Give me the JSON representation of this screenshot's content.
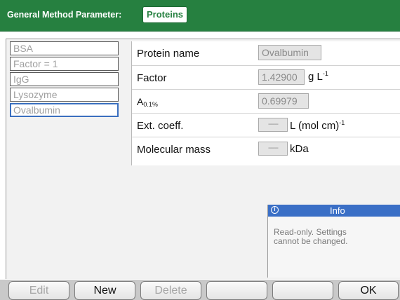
{
  "header": {
    "title": "General Method Parameter:",
    "tab": "Proteins"
  },
  "protein_list": [
    {
      "label": "BSA",
      "selected": false
    },
    {
      "label": "Factor = 1",
      "selected": false
    },
    {
      "label": "IgG",
      "selected": false
    },
    {
      "label": "Lysozyme",
      "selected": false
    },
    {
      "label": "Ovalbumin",
      "selected": true
    }
  ],
  "details": {
    "protein_name": {
      "label": "Protein name",
      "value": "Ovalbumin"
    },
    "factor": {
      "label": "Factor",
      "value": "1.42900",
      "unit": "g L",
      "unit_exp": "-1"
    },
    "a01": {
      "label": "A",
      "label_sub": "0.1%",
      "value": "0.69979"
    },
    "ext_coeff": {
      "label": "Ext. coeff.",
      "value": "------",
      "unit": "L (mol cm)",
      "unit_exp": "-1"
    },
    "mol_mass": {
      "label": "Molecular mass",
      "value": "------",
      "unit": "kDa"
    }
  },
  "info": {
    "icon": "info-icon",
    "title": "Info",
    "text": "Read-only. Settings cannot be changed."
  },
  "buttons": {
    "edit": "Edit",
    "new": "New",
    "delete": "Delete",
    "blank1": "",
    "blank2": "",
    "ok": "OK"
  },
  "colors": {
    "header_green": "#268040",
    "selection_blue": "#3a6fbf",
    "info_blue": "#3a6fc6"
  }
}
